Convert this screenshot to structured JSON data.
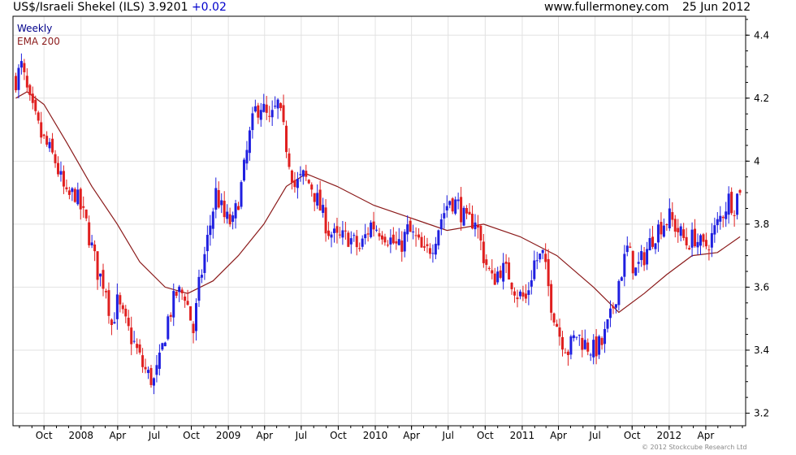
{
  "header": {
    "title": "US$/Israeli Shekel (ILS)",
    "last_price": "3.9201",
    "change": "+0.02",
    "website": "www.fullermoney.com",
    "date": "25 Jun 2012"
  },
  "legend": {
    "weekly": "Weekly",
    "ema": "EMA 200"
  },
  "copyright": "© 2012 Stockcube Research Ltd",
  "colors": {
    "up": "#1f1fe0",
    "down": "#e01f1f",
    "ema": "#8b1a1a",
    "grid": "#e2e2e2",
    "axis": "#000000"
  },
  "chart_data": {
    "type": "candlestick",
    "frequency": "weekly",
    "x_tick_labels": [
      "Oct",
      "2008",
      "Apr",
      "Jul",
      "Oct",
      "2009",
      "Apr",
      "Jul",
      "Oct",
      "2010",
      "Apr",
      "Jul",
      "Oct",
      "2011",
      "Apr",
      "Jul",
      "Oct",
      "2012",
      "Apr"
    ],
    "y_ticks": [
      3.2,
      3.4,
      3.6,
      3.8,
      4.0,
      4.2,
      4.4
    ],
    "y_tick_labels": [
      "3.2",
      "3.4",
      "3.6",
      "3.8",
      "4",
      "4.2",
      "4.4"
    ],
    "ylim": [
      3.16,
      4.46
    ],
    "x_range": [
      "2007-07-16",
      "2012-07-09"
    ],
    "grid": true,
    "price_anchors": [
      [
        "2007-07-23",
        4.26
      ],
      [
        "2007-08-06",
        4.3
      ],
      [
        "2007-08-27",
        4.18
      ],
      [
        "2007-09-24",
        4.08
      ],
      [
        "2007-10-29",
        4.0
      ],
      [
        "2007-11-26",
        3.88
      ],
      [
        "2007-12-17",
        3.9
      ],
      [
        "2008-01-14",
        3.8
      ],
      [
        "2008-02-11",
        3.65
      ],
      [
        "2008-03-03",
        3.6
      ],
      [
        "2008-03-17",
        3.48
      ],
      [
        "2008-03-31",
        3.55
      ],
      [
        "2008-04-21",
        3.48
      ],
      [
        "2008-05-12",
        3.42
      ],
      [
        "2008-06-02",
        3.35
      ],
      [
        "2008-06-16",
        3.32
      ],
      [
        "2008-06-30",
        3.3
      ],
      [
        "2008-07-14",
        3.36
      ],
      [
        "2008-08-04",
        3.5
      ],
      [
        "2008-08-25",
        3.58
      ],
      [
        "2008-09-15",
        3.58
      ],
      [
        "2008-10-06",
        3.46
      ],
      [
        "2008-10-20",
        3.6
      ],
      [
        "2008-11-10",
        3.75
      ],
      [
        "2008-12-01",
        3.9
      ],
      [
        "2008-12-22",
        3.82
      ],
      [
        "2009-01-12",
        3.8
      ],
      [
        "2009-02-02",
        3.92
      ],
      [
        "2009-02-23",
        4.08
      ],
      [
        "2009-03-09",
        4.16
      ],
      [
        "2009-03-23",
        4.18
      ],
      [
        "2009-04-13",
        4.12
      ],
      [
        "2009-05-04",
        4.18
      ],
      [
        "2009-05-25",
        4.05
      ],
      [
        "2009-06-15",
        3.92
      ],
      [
        "2009-07-06",
        3.95
      ],
      [
        "2009-07-27",
        3.92
      ],
      [
        "2009-08-17",
        3.85
      ],
      [
        "2009-09-07",
        3.78
      ],
      [
        "2009-09-28",
        3.75
      ],
      [
        "2009-10-26",
        3.76
      ],
      [
        "2009-11-23",
        3.72
      ],
      [
        "2009-12-21",
        3.8
      ],
      [
        "2010-01-18",
        3.78
      ],
      [
        "2010-02-08",
        3.75
      ],
      [
        "2010-03-01",
        3.72
      ],
      [
        "2010-03-22",
        3.78
      ],
      [
        "2010-04-12",
        3.75
      ],
      [
        "2010-05-03",
        3.7
      ],
      [
        "2010-05-24",
        3.74
      ],
      [
        "2010-06-14",
        3.82
      ],
      [
        "2010-07-05",
        3.88
      ],
      [
        "2010-07-26",
        3.86
      ],
      [
        "2010-08-16",
        3.8
      ],
      [
        "2010-09-06",
        3.82
      ],
      [
        "2010-09-27",
        3.7
      ],
      [
        "2010-10-18",
        3.62
      ],
      [
        "2010-11-08",
        3.66
      ],
      [
        "2010-11-29",
        3.64
      ],
      [
        "2010-12-20",
        3.58
      ],
      [
        "2011-01-10",
        3.56
      ],
      [
        "2011-01-31",
        3.68
      ],
      [
        "2011-02-21",
        3.7
      ],
      [
        "2011-03-14",
        3.55
      ],
      [
        "2011-04-04",
        3.45
      ],
      [
        "2011-04-25",
        3.4
      ],
      [
        "2011-05-16",
        3.45
      ],
      [
        "2011-06-06",
        3.42
      ],
      [
        "2011-06-27",
        3.4
      ],
      [
        "2011-07-18",
        3.42
      ],
      [
        "2011-08-08",
        3.5
      ],
      [
        "2011-08-29",
        3.62
      ],
      [
        "2011-09-19",
        3.72
      ],
      [
        "2011-10-10",
        3.65
      ],
      [
        "2011-10-31",
        3.7
      ],
      [
        "2011-11-21",
        3.76
      ],
      [
        "2011-12-12",
        3.8
      ],
      [
        "2012-01-02",
        3.82
      ],
      [
        "2012-01-23",
        3.78
      ],
      [
        "2012-02-13",
        3.74
      ],
      [
        "2012-03-05",
        3.76
      ],
      [
        "2012-03-26",
        3.72
      ],
      [
        "2012-04-16",
        3.76
      ],
      [
        "2012-05-07",
        3.82
      ],
      [
        "2012-05-28",
        3.88
      ],
      [
        "2012-06-11",
        3.86
      ],
      [
        "2012-06-25",
        3.92
      ]
    ],
    "ema_200": [
      [
        "2007-07-23",
        4.2
      ],
      [
        "2007-08-20",
        4.22
      ],
      [
        "2007-10-01",
        4.18
      ],
      [
        "2007-11-26",
        4.06
      ],
      [
        "2008-01-28",
        3.92
      ],
      [
        "2008-03-31",
        3.8
      ],
      [
        "2008-05-26",
        3.68
      ],
      [
        "2008-07-28",
        3.6
      ],
      [
        "2008-09-22",
        3.58
      ],
      [
        "2008-11-24",
        3.62
      ],
      [
        "2009-01-26",
        3.7
      ],
      [
        "2009-03-30",
        3.8
      ],
      [
        "2009-05-25",
        3.92
      ],
      [
        "2009-07-13",
        3.96
      ],
      [
        "2009-09-28",
        3.92
      ],
      [
        "2009-12-28",
        3.86
      ],
      [
        "2010-03-29",
        3.82
      ],
      [
        "2010-06-28",
        3.78
      ],
      [
        "2010-09-27",
        3.8
      ],
      [
        "2010-12-27",
        3.76
      ],
      [
        "2011-03-28",
        3.7
      ],
      [
        "2011-06-27",
        3.6
      ],
      [
        "2011-08-29",
        3.52
      ],
      [
        "2011-10-31",
        3.58
      ],
      [
        "2011-12-26",
        3.64
      ],
      [
        "2012-02-27",
        3.7
      ],
      [
        "2012-04-30",
        3.71
      ],
      [
        "2012-06-25",
        3.76
      ]
    ]
  }
}
